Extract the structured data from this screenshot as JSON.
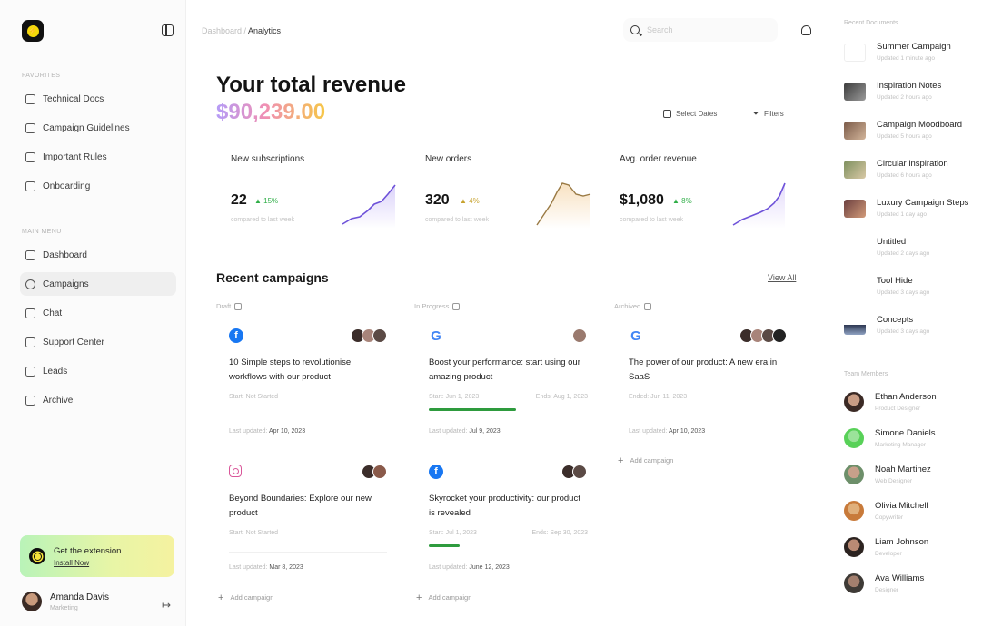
{
  "sidebar": {
    "favorites_title": "Favorites",
    "favorites": [
      {
        "label": "Technical Docs"
      },
      {
        "label": "Campaign Guidelines"
      },
      {
        "label": "Important Rules"
      },
      {
        "label": "Onboarding"
      }
    ],
    "main_title": "Main Menu",
    "main": [
      {
        "label": "Dashboard"
      },
      {
        "label": "Campaigns"
      },
      {
        "label": "Chat"
      },
      {
        "label": "Support Center"
      },
      {
        "label": "Leads"
      },
      {
        "label": "Archive"
      }
    ],
    "promo": {
      "title": "Get the extension",
      "link": "Install Now"
    },
    "user": {
      "name": "Amanda Davis",
      "role": "Marketing"
    }
  },
  "topbar": {
    "crumb_parent": "Dashboard",
    "crumb_current": "Analytics",
    "search_placeholder": "Search"
  },
  "main": {
    "title": "Your total revenue",
    "revenue": "$90,239.00",
    "select_dates": "Select Dates",
    "filters": "Filters"
  },
  "stats": [
    {
      "title": "New subscriptions",
      "value": "22",
      "delta": "▲ 15%",
      "sub": "compared to last week"
    },
    {
      "title": "New orders",
      "value": "320",
      "delta": "▲ 4%",
      "sub": "compared to last week"
    },
    {
      "title": "Avg. order revenue",
      "value": "$1,080",
      "delta": "▲ 8%",
      "sub": "compared to last week"
    }
  ],
  "campaigns": {
    "title": "Recent campaigns",
    "view_all": "View All",
    "columns": [
      {
        "label": "Draft",
        "add": "Add campaign",
        "cards": [
          {
            "title": "10 Simple steps to revolutionise workflows with our product",
            "start": "Start: Not Started",
            "end": "",
            "updated_prefix": "Last updated:",
            "updated": "Apr 10, 2023"
          },
          {
            "title": "Beyond Boundaries: Explore our new product",
            "start": "Start: Not Started",
            "end": "",
            "updated_prefix": "Last updated:",
            "updated": "Mar 8, 2023"
          }
        ]
      },
      {
        "label": "In Progress",
        "add": "Add campaign",
        "cards": [
          {
            "title": "Boost your performance: start using our amazing product",
            "start": "Start: Jun 1, 2023",
            "end": "Ends: Aug 1, 2023",
            "updated_prefix": "Last updated:",
            "updated": "Jul 9, 2023"
          },
          {
            "title": "Skyrocket your productivity: our product is revealed",
            "start": "Start: Jul 1, 2023",
            "end": "Ends: Sep 30, 2023",
            "updated_prefix": "Last updated:",
            "updated": "June 12, 2023"
          }
        ]
      },
      {
        "label": "Archived",
        "add": "Add campaign",
        "cards": [
          {
            "title": "The power of our product: A new era in SaaS",
            "start": "Ended: Jun 11, 2023",
            "end": "",
            "updated_prefix": "Last updated:",
            "updated": "Apr 10, 2023"
          }
        ]
      }
    ]
  },
  "right_panel": {
    "docs_title": "Recent Documents",
    "docs": [
      {
        "name": "Summer Campaign",
        "sub": "Updated 1 minute ago"
      },
      {
        "name": "Inspiration Notes",
        "sub": "Updated 2 hours ago"
      },
      {
        "name": "Campaign Moodboard",
        "sub": "Updated 5 hours ago"
      },
      {
        "name": "Circular inspiration",
        "sub": "Updated 6 hours ago"
      },
      {
        "name": "Luxury Campaign Steps",
        "sub": "Updated 1 day ago"
      },
      {
        "name": "Untitled",
        "sub": "Updated 2 days ago"
      },
      {
        "name": "Tool Hide",
        "sub": "Updated 3 days ago"
      },
      {
        "name": "Concepts",
        "sub": "Updated 3 days ago"
      }
    ],
    "team_title": "Team Members",
    "team": [
      {
        "name": "Ethan Anderson",
        "role": "Product Designer"
      },
      {
        "name": "Simone Daniels",
        "role": "Marketing Manager"
      },
      {
        "name": "Noah Martinez",
        "role": "Web Designer"
      },
      {
        "name": "Olivia Mitchell",
        "role": "Copywriter"
      },
      {
        "name": "Liam Johnson",
        "role": "Developer"
      },
      {
        "name": "Ava Williams",
        "role": "Designer"
      }
    ]
  },
  "colors": {
    "accent_green": "#2e9b3e",
    "brand_yellow": "#f5d90a"
  }
}
